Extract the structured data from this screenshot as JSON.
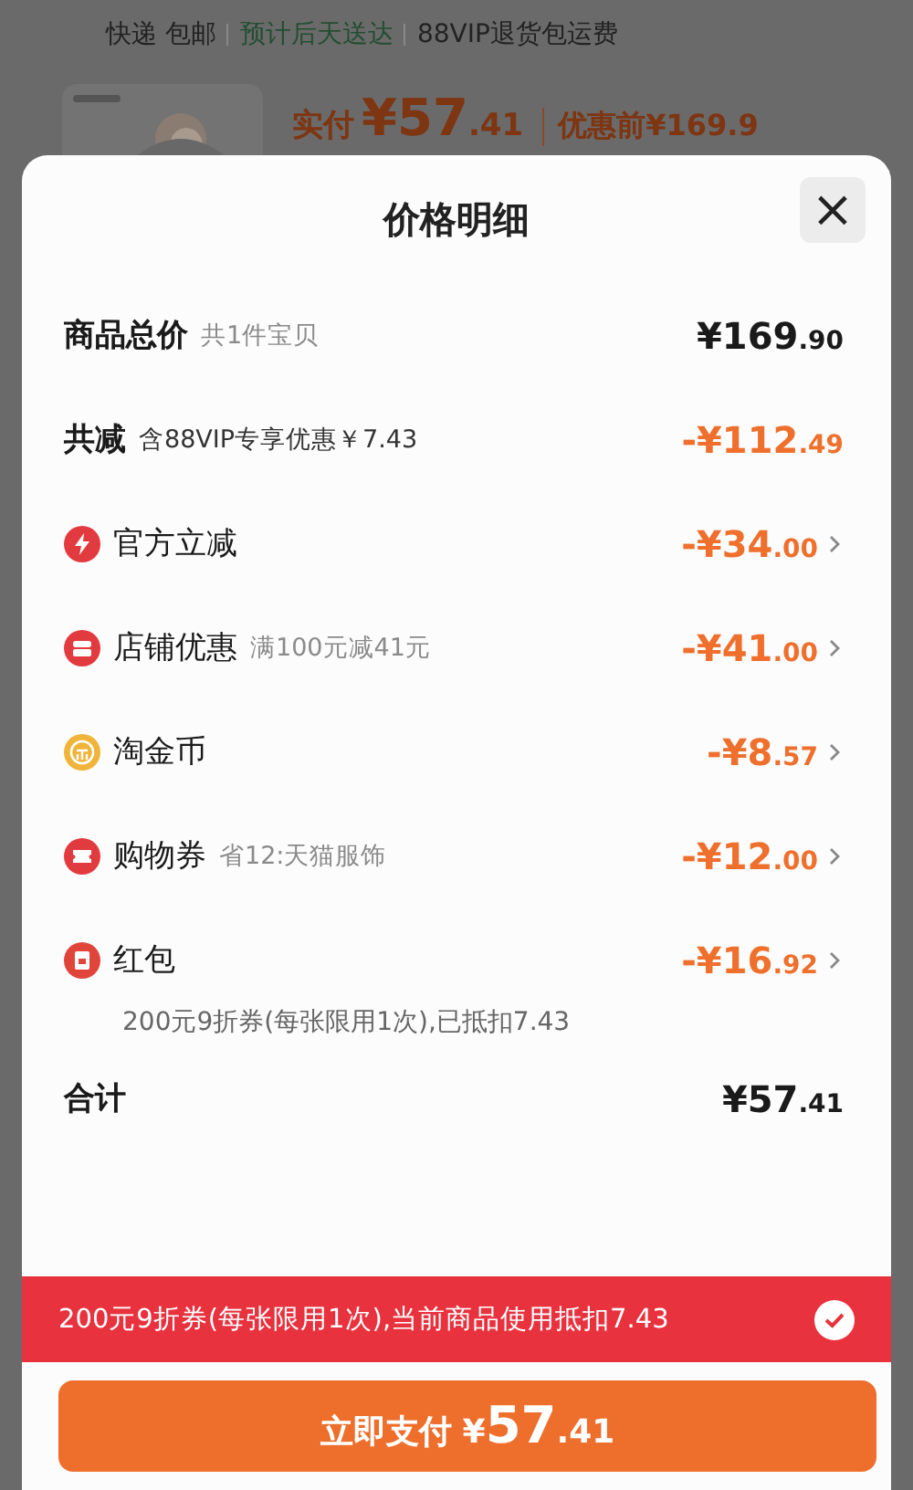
{
  "background": {
    "shipping": [
      {
        "text": "快递 包邮",
        "kind": "plain"
      },
      {
        "text": "预计后天送达",
        "kind": "highlight"
      },
      {
        "text": "88VIP退货包运费",
        "kind": "plain"
      }
    ],
    "product": {
      "paid_label": "实付",
      "paid": {
        "main": "¥57",
        "decimal": ".41"
      },
      "before_label": "优惠前¥169.9"
    }
  },
  "sheet": {
    "title": "价格明细",
    "close": "×",
    "rows": [
      {
        "kind": "total",
        "label": "商品总价",
        "note": "共1件宝贝",
        "price": {
          "main": "¥169",
          "decimal": ".90"
        }
      },
      {
        "kind": "summary",
        "label": "共减",
        "note": "含88VIP专享优惠￥7.43",
        "price": {
          "main": "-¥112",
          "decimal": ".49"
        }
      },
      {
        "kind": "discount",
        "label": "官方立减",
        "price": {
          "main": "-¥34",
          "decimal": ".00"
        }
      },
      {
        "kind": "discount",
        "label": "店铺优惠",
        "note": "满100元减41元",
        "price": {
          "main": "-¥41",
          "decimal": ".00"
        }
      },
      {
        "kind": "discount",
        "label": "淘金币",
        "price": {
          "main": "-¥8",
          "decimal": ".57"
        }
      },
      {
        "kind": "discount",
        "label": "购物券",
        "note": "省12:天猫服饰",
        "price": {
          "main": "-¥12",
          "decimal": ".00"
        }
      },
      {
        "kind": "discount",
        "label": "红包",
        "price": {
          "main": "-¥16",
          "decimal": ".92"
        },
        "detail": "200元9折券(每张限用1次),已抵扣7.43"
      },
      {
        "kind": "total",
        "label": "合计",
        "price": {
          "main": "¥57",
          "decimal": ".41"
        }
      }
    ],
    "banner": {
      "text": "200元9折券(每张限用1次),当前商品使用抵扣7.43",
      "checked": true
    },
    "pay_button": {
      "label": "立即支付",
      "price": {
        "main": "¥57",
        "decimal": ".41"
      }
    }
  }
}
